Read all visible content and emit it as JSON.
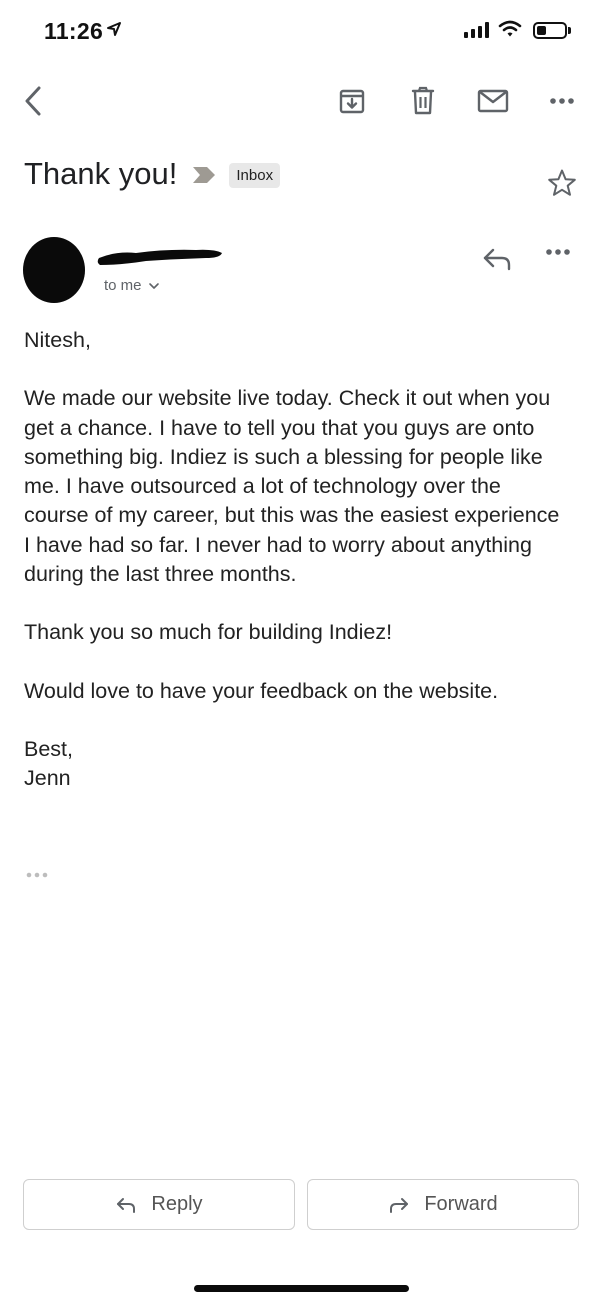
{
  "status_bar": {
    "time": "11:26"
  },
  "toolbar": {
    "icons": [
      "back-icon",
      "archive-icon",
      "delete-icon",
      "mark-unread-icon",
      "more-icon"
    ]
  },
  "email": {
    "subject": "Thank you!",
    "label": "Inbox",
    "recipient_text": "to me",
    "body": [
      "Nitesh,",
      "We made our website live today. Check it out when you get a chance. I have to tell you that you guys are onto something big. Indiez is such a blessing for people like me. I have outsourced a lot of technology over the course of my career, but this was the easiest experience I have had so far. I never had to worry about anything during the last three months.",
      "Thank you so much for building Indiez!",
      "Would love to have your feedback on the website.",
      "Best,",
      "Jenn"
    ]
  },
  "actions": {
    "reply_label": "Reply",
    "forward_label": "Forward"
  },
  "colors": {
    "text": "#222222",
    "muted": "#5f6368",
    "icon": "#5f6368",
    "chip_bg": "#e8e8e8",
    "importance": "#9e9a93"
  }
}
